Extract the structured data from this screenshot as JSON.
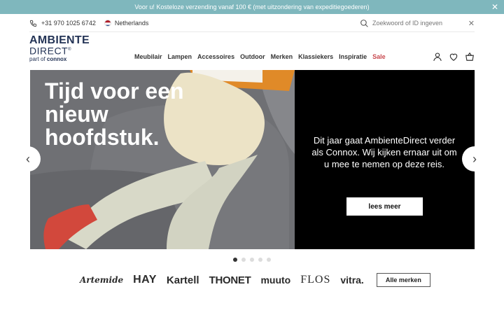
{
  "promo": {
    "text": "Voor u! Kosteloze verzending vanaf 100 € (met uitzondering van expeditiegoederen)",
    "close_icon": "close-icon"
  },
  "utility": {
    "phone": "+31 970 1025 6742",
    "country": "Netherlands",
    "search_placeholder": "Zoekwoord of ID ingeven",
    "phone_icon": "phone-icon",
    "flag_icon": "netherlands-flag-icon",
    "search_icon": "search-icon",
    "clear_icon": "close-icon"
  },
  "logo": {
    "line1": "AMBIENTE",
    "line2": "DIRECT",
    "trademark": "®",
    "line3_prefix": "part of",
    "line3_brand": "connox"
  },
  "nav": {
    "items": [
      "Meubilair",
      "Lampen",
      "Accessoires",
      "Outdoor",
      "Merken",
      "Klassiekers",
      "Inspiratie",
      "Sale"
    ]
  },
  "header_icons": [
    "account-icon",
    "heart-icon",
    "basket-icon"
  ],
  "hero": {
    "title": "Tijd voor een nieuw hoofdstuk.",
    "text": "Dit jaar gaat AmbienteDirect verder als Connox. Wij kijken ernaar uit om u mee te nemen op deze reis.",
    "cta": "lees meer",
    "prev_icon": "chevron-left-icon",
    "next_icon": "chevron-right-icon"
  },
  "carousel": {
    "slides": 5,
    "active": 1
  },
  "brands": [
    "Artemide",
    "HAY",
    "Kartell",
    "THONET",
    "muuto",
    "FLOS",
    "vitra."
  ],
  "all_brands_label": "Alle merken",
  "colors": {
    "promo_bg": "#7fb7bd",
    "logo": "#243456",
    "sale": "#c8474d",
    "hero_black": "#000000",
    "chair": "#6f7074",
    "sock": "#d2483c",
    "sweater": "#ece3c6",
    "trousers": "#d8d9c8",
    "folder": "#e08a28"
  }
}
